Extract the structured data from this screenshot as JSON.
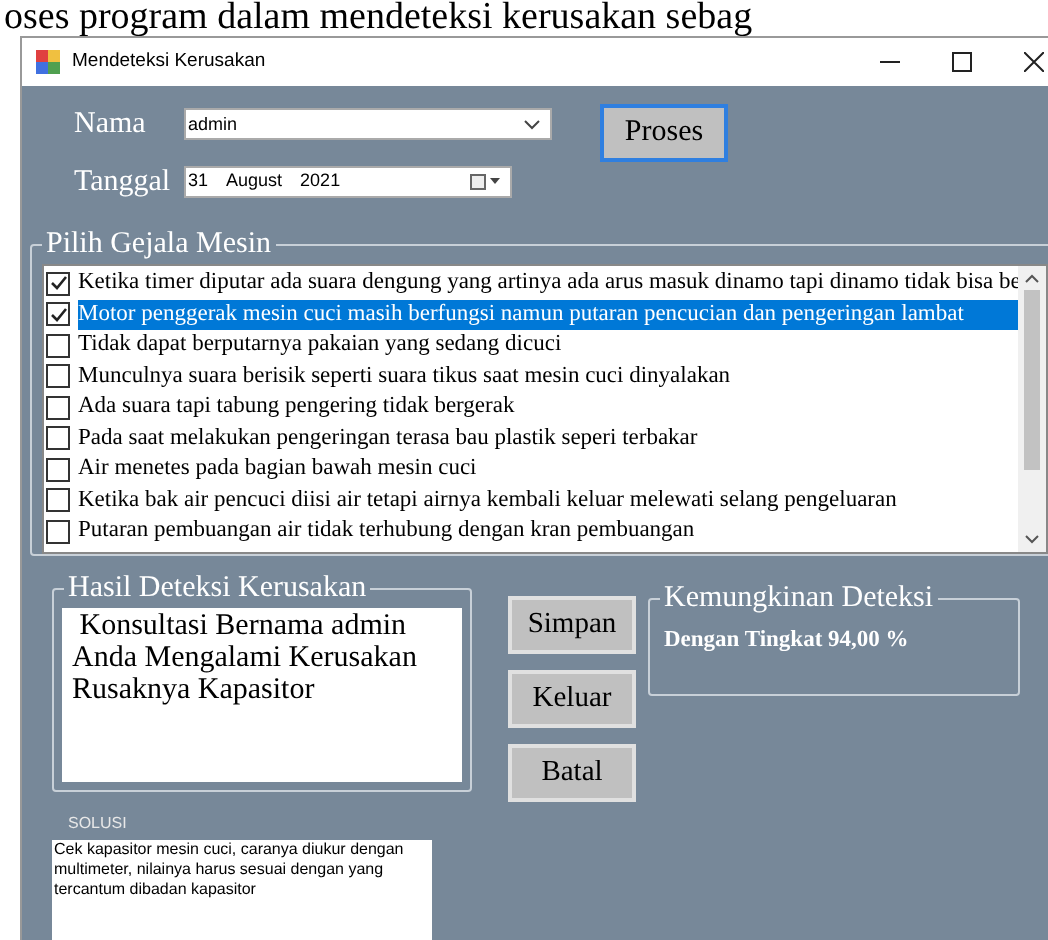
{
  "document_text": "oses program dalam mendeteksi kerusakan sebag",
  "window": {
    "title": "Mendeteksi Kerusakan"
  },
  "form": {
    "name_label": "Nama",
    "name_value": "admin",
    "date_label": "Tanggal",
    "date_day": "31",
    "date_month": "August",
    "date_year": "2021",
    "process_button": "Proses"
  },
  "symptoms": {
    "title": "Pilih Gejala Mesin",
    "items": [
      {
        "label": "Ketika timer diputar ada suara dengung yang artinya ada arus masuk dinamo tapi dinamo tidak bisa be",
        "checked": true,
        "selected": false
      },
      {
        "label": "Motor penggerak mesin cuci masih berfungsi namun putaran pencucian dan pengeringan lambat",
        "checked": true,
        "selected": true
      },
      {
        "label": "Tidak dapat berputarnya pakaian yang sedang dicuci",
        "checked": false,
        "selected": false
      },
      {
        "label": "Munculnya suara berisik seperti suara tikus saat mesin cuci dinyalakan",
        "checked": false,
        "selected": false
      },
      {
        "label": "Ada suara tapi tabung pengering tidak bergerak",
        "checked": false,
        "selected": false
      },
      {
        "label": "Pada saat melakukan pengeringan terasa bau plastik seperi terbakar",
        "checked": false,
        "selected": false
      },
      {
        "label": "Air menetes pada bagian bawah mesin cuci",
        "checked": false,
        "selected": false
      },
      {
        "label": "Ketika bak air pencuci diisi air tetapi airnya kembali keluar melewati selang pengeluaran",
        "checked": false,
        "selected": false
      },
      {
        "label": "Putaran pembuangan air tidak terhubung dengan kran pembuangan",
        "checked": false,
        "selected": false
      }
    ]
  },
  "result": {
    "title": "Hasil Deteksi Kerusakan",
    "lines": [
      " Konsultasi Bernama admin",
      "Anda Mengalami Kerusakan",
      "Rusaknya Kapasitor"
    ]
  },
  "buttons": [
    "Simpan",
    "Keluar",
    "Batal"
  ],
  "probability": {
    "title": "Kemungkinan Deteksi",
    "text": "Dengan Tingkat 94,00 %"
  },
  "solution": {
    "label": "SOLUSI",
    "text": "Cek kapasitor mesin cuci, caranya diukur dengan multimeter, nilainya harus sesuai dengan yang tercantum dibadan kapasitor"
  }
}
